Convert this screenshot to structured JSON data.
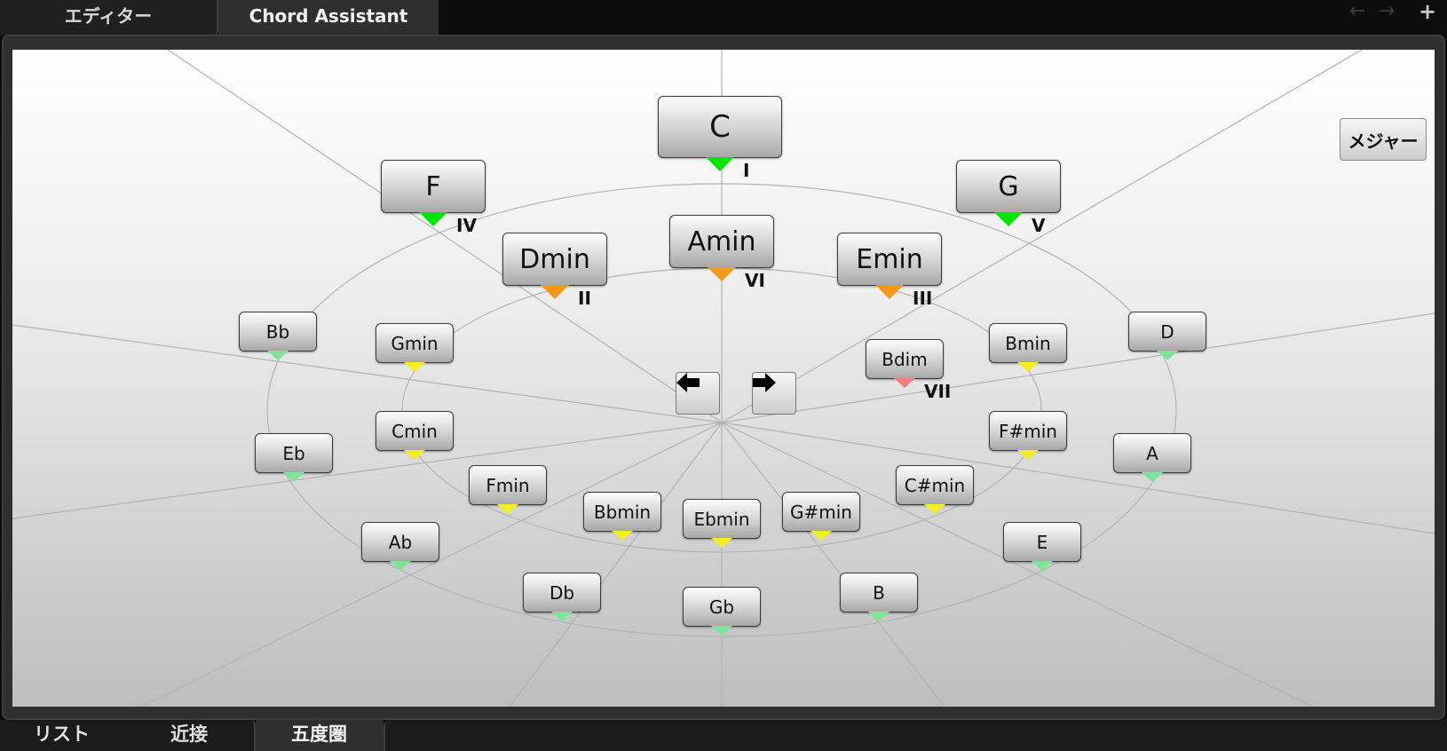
{
  "top_tabs": [
    {
      "label": "エディター"
    },
    {
      "label": "Chord Assistant"
    }
  ],
  "nav": {
    "back": "←",
    "forward": "→",
    "add": "+"
  },
  "mode_button": {
    "label": "メジャー"
  },
  "arrows": {
    "prev": "◀",
    "next": "▶"
  },
  "chords": [
    {
      "label": "C",
      "marker": "#00e600",
      "degree": "I"
    },
    {
      "label": "F",
      "marker": "#00e600",
      "degree": "IV"
    },
    {
      "label": "G",
      "marker": "#00e600",
      "degree": "V"
    },
    {
      "label": "Amin",
      "marker": "#f39a1e",
      "degree": "VI"
    },
    {
      "label": "Dmin",
      "marker": "#f39a1e",
      "degree": "II"
    },
    {
      "label": "Emin",
      "marker": "#f39a1e",
      "degree": "III"
    },
    {
      "label": "Bdim",
      "marker": "#f08080",
      "degree": "VII"
    },
    {
      "label": "Bb",
      "marker": "#7fe39a"
    },
    {
      "label": "Eb",
      "marker": "#7fe39a"
    },
    {
      "label": "Ab",
      "marker": "#7fe39a"
    },
    {
      "label": "Db",
      "marker": "#7fe39a"
    },
    {
      "label": "Gb",
      "marker": "#7fe39a"
    },
    {
      "label": "B",
      "marker": "#7fe39a"
    },
    {
      "label": "E",
      "marker": "#7fe39a"
    },
    {
      "label": "A",
      "marker": "#7fe39a"
    },
    {
      "label": "D",
      "marker": "#7fe39a"
    },
    {
      "label": "Gmin",
      "marker": "#f2ee22"
    },
    {
      "label": "Cmin",
      "marker": "#f2ee22"
    },
    {
      "label": "Fmin",
      "marker": "#f2ee22"
    },
    {
      "label": "Bbmin",
      "marker": "#f2ee22"
    },
    {
      "label": "Ebmin",
      "marker": "#f2ee22"
    },
    {
      "label": "G#min",
      "marker": "#f2ee22"
    },
    {
      "label": "C#min",
      "marker": "#f2ee22"
    },
    {
      "label": "F#min",
      "marker": "#f2ee22"
    },
    {
      "label": "Bmin",
      "marker": "#f2ee22"
    }
  ],
  "bottom_tabs": [
    {
      "label": "リスト"
    },
    {
      "label": "近接"
    },
    {
      "label": "五度圏"
    }
  ]
}
